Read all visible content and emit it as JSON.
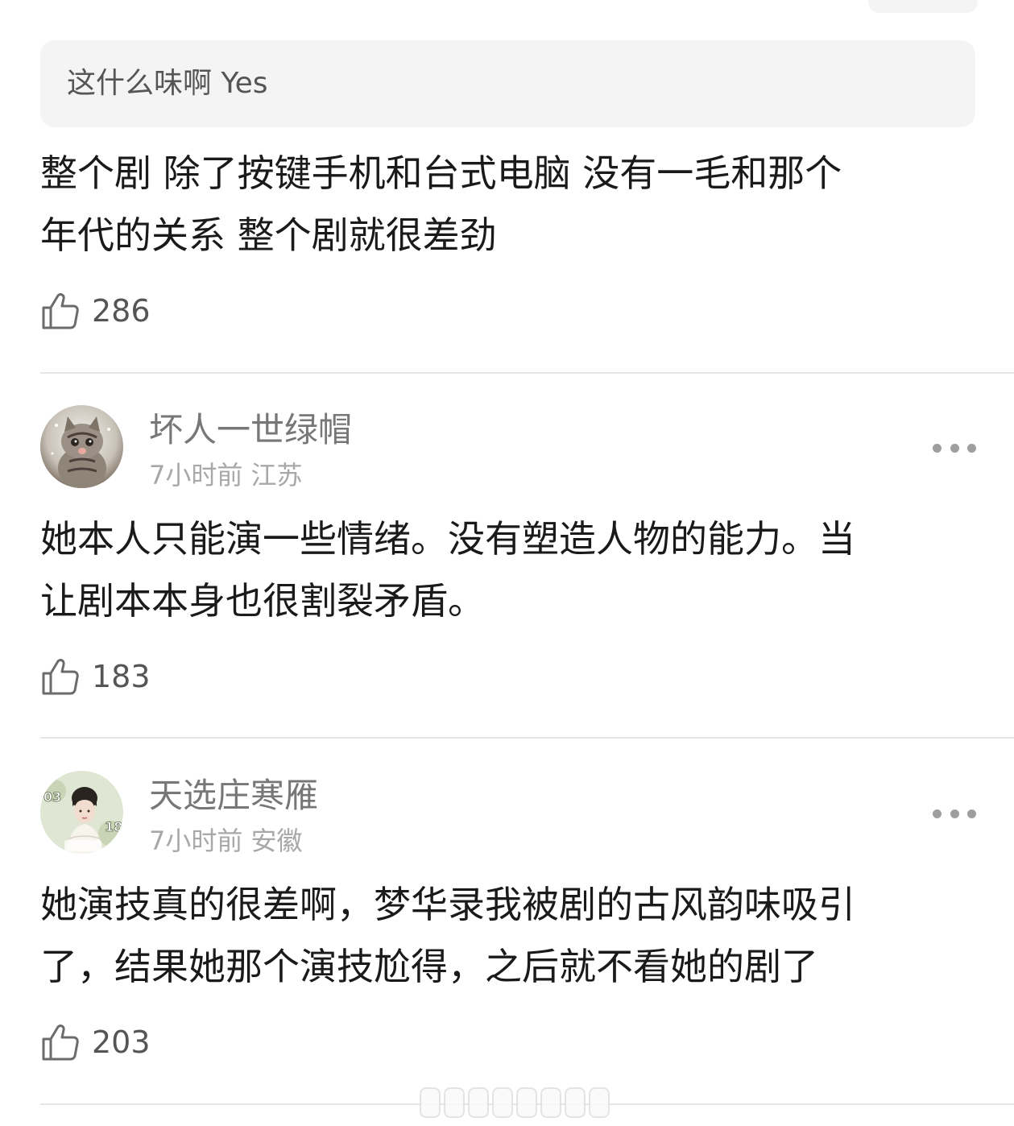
{
  "quote": {
    "text": "这什么味啊 Yes"
  },
  "comments": [
    {
      "text_lines": [
        "整个剧 除了按键手机和台式电脑 没有一毛和那个",
        "年代的关系 整个剧就很差劲"
      ],
      "likes": "286"
    },
    {
      "username": "坏人一世绿帽",
      "time": "7小时前",
      "location": "江苏",
      "text_lines": [
        "她本人只能演一些情绪。没有塑造人物的能力。当",
        "让剧本本身也很割裂矛盾。"
      ],
      "likes": "183"
    },
    {
      "username": "天选庄寒雁",
      "time": "7小时前",
      "location": "安徽",
      "avatar_text": [
        "03",
        "18"
      ],
      "text_lines": [
        "她演技真的很差啊，梦华录我被剧的古风韵味吸引",
        "了，结果她那个演技尬得，之后就不看她的剧了"
      ],
      "likes": "203"
    }
  ],
  "icons": {
    "like": "thumbs-up-icon",
    "more": "more-dots-icon"
  },
  "colors": {
    "text_primary": "#1a1a1a",
    "text_secondary": "#555555",
    "username": "#777777",
    "meta": "#a8a8a8",
    "quote_bg": "#f4f4f4",
    "divider": "#e6e6e6"
  }
}
